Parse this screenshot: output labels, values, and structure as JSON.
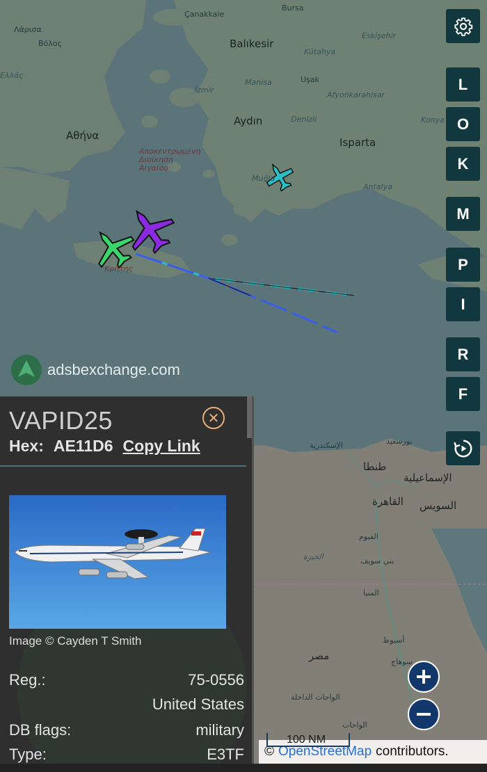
{
  "map": {
    "labels": [
      {
        "text": "Çanakkale",
        "cls": "gr"
      },
      {
        "text": "Bursa",
        "cls": "gr"
      },
      {
        "text": "Λάρισα",
        "cls": "gr"
      },
      {
        "text": "Βόλος",
        "cls": "gr"
      },
      {
        "text": "Balıkesir",
        "cls": "big"
      },
      {
        "text": "Kütahya",
        "cls": "small"
      },
      {
        "text": "Eskişehir",
        "cls": "small"
      },
      {
        "text": "Ελλάς",
        "cls": "small"
      },
      {
        "text": "İzmir",
        "cls": "small"
      },
      {
        "text": "Manisa",
        "cls": "small"
      },
      {
        "text": "Uşak",
        "cls": "gr"
      },
      {
        "text": "Αθήνα",
        "cls": "big"
      },
      {
        "text": "Aydın",
        "cls": "big"
      },
      {
        "text": "Denizli",
        "cls": "small"
      },
      {
        "text": "Isparta",
        "cls": "big"
      },
      {
        "text": "Afyonkarahisar",
        "cls": "small"
      },
      {
        "text": "Konya",
        "cls": "small"
      },
      {
        "text": "Αποκεντρωμένη Διοίκηση Αιγαίου",
        "cls": "red"
      },
      {
        "text": "Muğla",
        "cls": "small"
      },
      {
        "text": "Antalya",
        "cls": "small"
      },
      {
        "text": "Κρήτης",
        "cls": "red"
      },
      {
        "text": "الإسكندرية",
        "cls": "gr"
      },
      {
        "text": "بورسعيد",
        "cls": "gr"
      },
      {
        "text": "طنطا",
        "cls": "big"
      },
      {
        "text": "الإسماعيلية",
        "cls": "big"
      },
      {
        "text": "القاهرة",
        "cls": "big"
      },
      {
        "text": "السويس",
        "cls": "big"
      },
      {
        "text": "الجيزة",
        "cls": "small"
      },
      {
        "text": "الفيوم",
        "cls": "gr"
      },
      {
        "text": "بني سويف",
        "cls": "gr"
      },
      {
        "text": "المنيا",
        "cls": "gr"
      },
      {
        "text": "أسيوط",
        "cls": "gr"
      },
      {
        "text": "مصر",
        "cls": "big"
      },
      {
        "text": "سوهاج",
        "cls": "gr"
      },
      {
        "text": "الواحات الداخلة",
        "cls": "gr"
      },
      {
        "text": "الواحات",
        "cls": "gr"
      }
    ]
  },
  "toolbar": {
    "settings_icon": "gear-icon",
    "buttons": [
      "L",
      "O",
      "K",
      "M",
      "P",
      "I",
      "R",
      "F"
    ],
    "replay_icon": "replay-icon"
  },
  "branding": {
    "text": "adsbexchange.com"
  },
  "aircraft_markers": [
    {
      "name": "purple-aircraft",
      "color": "#8a2be2"
    },
    {
      "name": "green-aircraft",
      "color": "#3cd66e"
    },
    {
      "name": "cyan-aircraft",
      "color": "#2bbfc4"
    }
  ],
  "panel": {
    "callsign": "VAPID25",
    "hex_label": "Hex:",
    "hex_value": "AE11D6",
    "copy_link": "Copy Link",
    "image_credit": "Image © Cayden T Smith",
    "reg_label": "Reg.:",
    "reg_value": "75-0556",
    "country": "United States",
    "db_flags_label": "DB flags:",
    "db_flags_value": "military",
    "type_label": "Type:",
    "type_value": "E3TF"
  },
  "zoom": {
    "in": "+",
    "out": "−"
  },
  "scale": {
    "label": "100 NM"
  },
  "attribution": {
    "prefix": "©",
    "link": "OpenStreetMap",
    "suffix": "contributors."
  }
}
